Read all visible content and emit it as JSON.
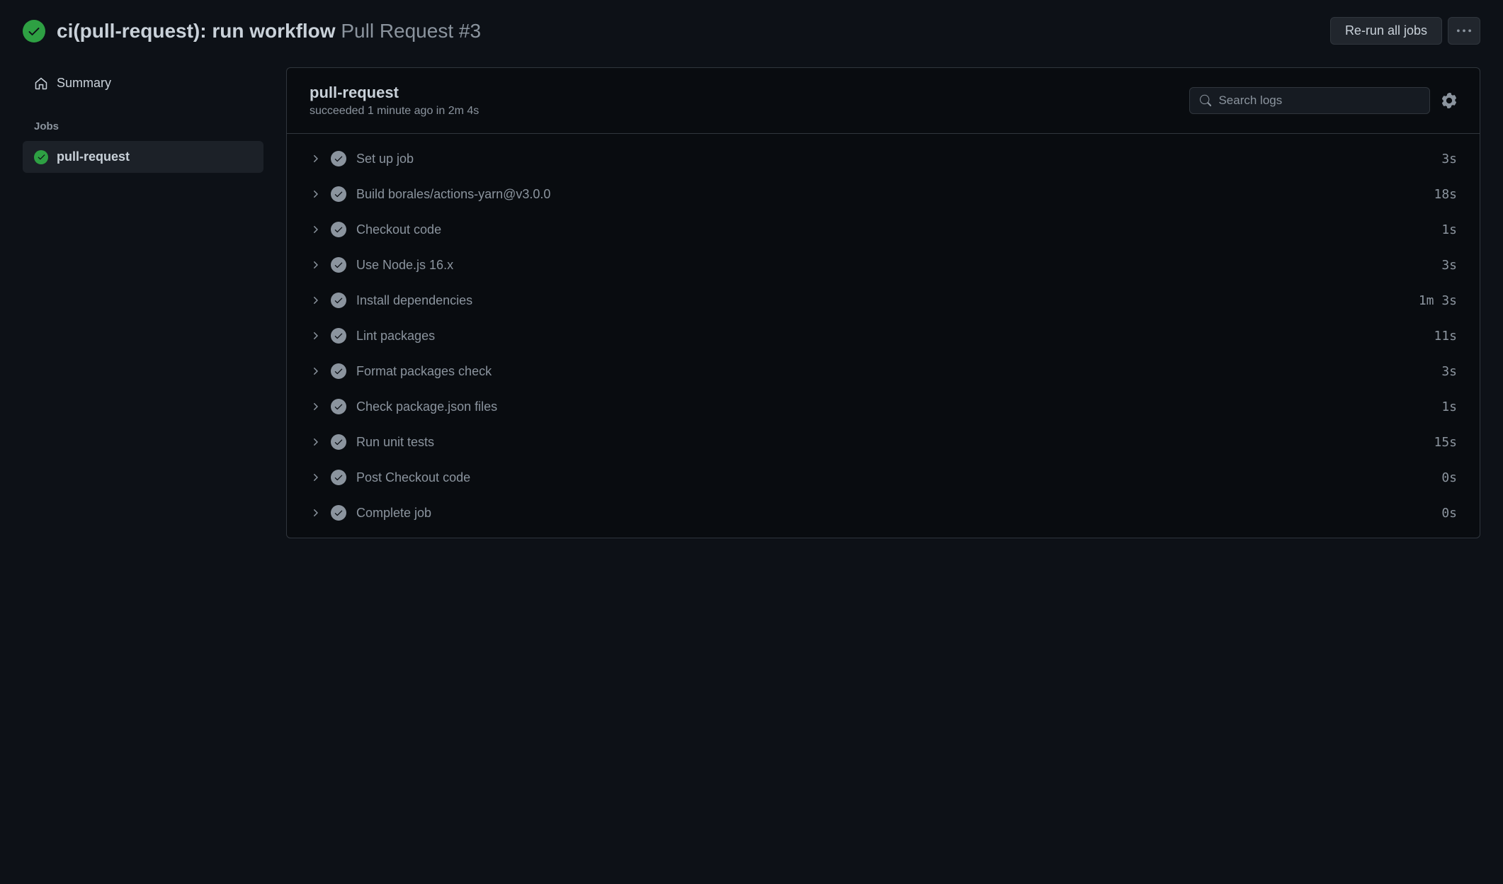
{
  "header": {
    "title_bold": "ci(pull-request): run workflow",
    "title_muted": "Pull Request #3",
    "rerun_label": "Re-run all jobs"
  },
  "sidebar": {
    "summary_label": "Summary",
    "jobs_heading": "Jobs",
    "jobs": [
      {
        "label": "pull-request",
        "status": "success",
        "active": true
      }
    ]
  },
  "job": {
    "name": "pull-request",
    "status_line": "succeeded 1 minute ago in 2m 4s",
    "search_placeholder": "Search logs",
    "steps": [
      {
        "name": "Set up job",
        "duration": "3s"
      },
      {
        "name": "Build borales/actions-yarn@v3.0.0",
        "duration": "18s"
      },
      {
        "name": "Checkout code",
        "duration": "1s"
      },
      {
        "name": "Use Node.js 16.x",
        "duration": "3s"
      },
      {
        "name": "Install dependencies",
        "duration": "1m 3s"
      },
      {
        "name": "Lint packages",
        "duration": "11s"
      },
      {
        "name": "Format packages check",
        "duration": "3s"
      },
      {
        "name": "Check package.json files",
        "duration": "1s"
      },
      {
        "name": "Run unit tests",
        "duration": "15s"
      },
      {
        "name": "Post Checkout code",
        "duration": "0s"
      },
      {
        "name": "Complete job",
        "duration": "0s"
      }
    ]
  }
}
